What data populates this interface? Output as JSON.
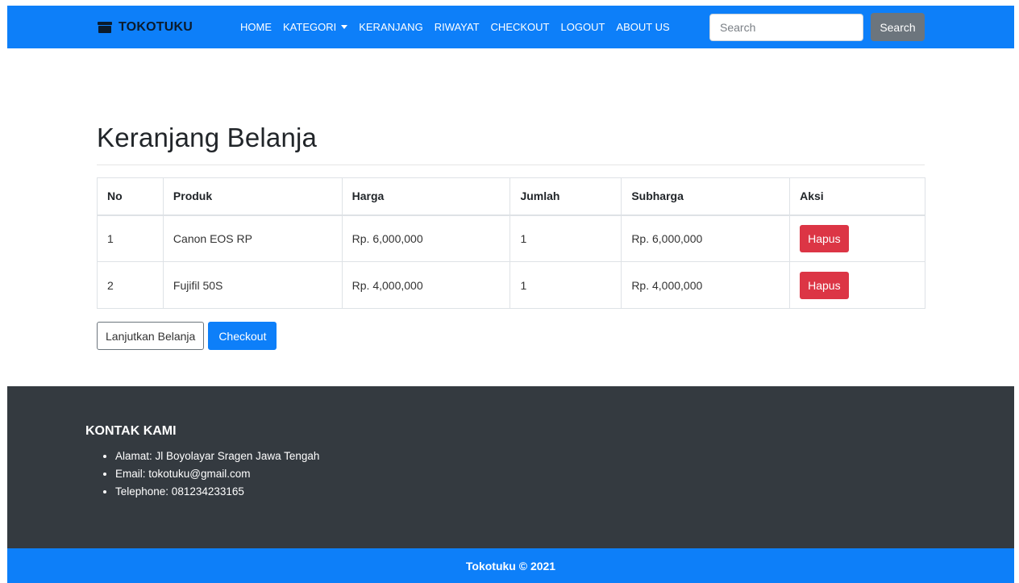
{
  "navbar": {
    "brand": "TOKOTUKU",
    "brand_icon": "shop-icon",
    "links": [
      {
        "label": "HOME"
      },
      {
        "label": "KATEGORI",
        "dropdown": true
      },
      {
        "label": "KERANJANG"
      },
      {
        "label": "RIWAYAT"
      },
      {
        "label": "CHECKOUT"
      },
      {
        "label": "LOGOUT"
      },
      {
        "label": "ABOUT US"
      }
    ],
    "search_placeholder": "Search",
    "search_button": "Search"
  },
  "main": {
    "title": "Keranjang Belanja",
    "table": {
      "headers": [
        "No",
        "Produk",
        "Harga",
        "Jumlah",
        "Subharga",
        "Aksi"
      ],
      "rows": [
        {
          "no": "1",
          "produk": "Canon EOS RP",
          "harga": "Rp. 6,000,000",
          "jumlah": "1",
          "subharga": "Rp. 6,000,000",
          "aksi": "Hapus"
        },
        {
          "no": "2",
          "produk": "Fujifil 50S",
          "harga": "Rp. 4,000,000",
          "jumlah": "1",
          "subharga": "Rp. 4,000,000",
          "aksi": "Hapus"
        }
      ]
    },
    "buttons": {
      "continue": "Lanjutkan Belanja",
      "checkout": "Checkout"
    }
  },
  "footer": {
    "heading": "KONTAK KAMI",
    "items": [
      "Alamat: Jl Boyolayar Sragen Jawa Tengah",
      "Email: tokotuku@gmail.com",
      "Telephone: 081234233165"
    ],
    "copyright": "Tokotuku © 2021"
  },
  "colors": {
    "primary": "#0d7ff9",
    "danger": "#dc3545",
    "secondary": "#6c757d",
    "footer_dark": "#343a40"
  }
}
